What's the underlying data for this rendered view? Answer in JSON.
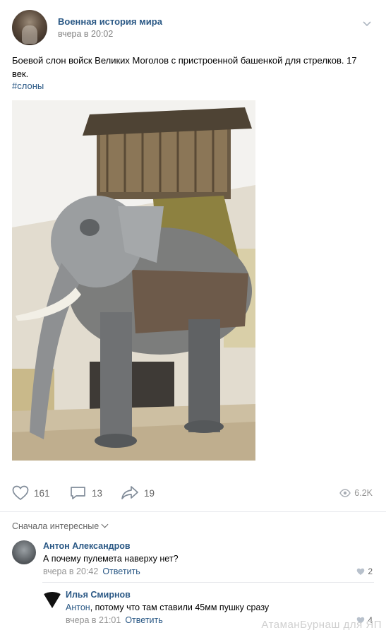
{
  "post": {
    "group_name": "Военная история мира",
    "time": "вчера в 20:02",
    "text": "Боевой слон войск Великих Моголов с пристроенной башенкой для стрелков. 17 век.",
    "hashtag": "#слоны"
  },
  "actions": {
    "likes": "161",
    "comments": "13",
    "shares": "19",
    "views": "6.2K"
  },
  "comments_section": {
    "sort_label": "Сначала интересные",
    "comments": [
      {
        "author": "Антон Александров",
        "text": "А почему пулемета наверху нет?",
        "time": "вчера в 20:42",
        "reply_label": "Ответить",
        "likes": "2"
      },
      {
        "author": "Илья Смирнов",
        "address": "Антон",
        "text": ", потому что там ставили 45мм пушку сразу",
        "time": "вчера в 21:01",
        "reply_label": "Ответить",
        "likes": "4"
      }
    ]
  },
  "watermark": "АтаманБурнаш для ЯП",
  "colors": {
    "link": "#2a5885",
    "muted": "#828282",
    "separator": "#e7e8ec"
  }
}
